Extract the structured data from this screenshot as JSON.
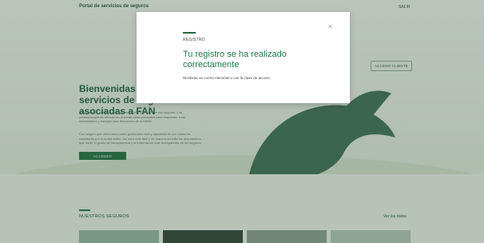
{
  "header": {
    "brand": "Portal de servicios de seguros",
    "right_label": "SALIR"
  },
  "hero": {
    "title_lines": [
      "Bienvenidas y b",
      "servicios de seg",
      "asociadas a FAN"
    ],
    "access_button": "ACCESO CLIENTE",
    "paragraph_1": [
      "Este portal le permite consultar las pólizas y gestión de sus seguros. Los",
      "productos que se ofrecen en el portal están pensados para responder a las",
      "necesidades y trabajos más frecuentes de la FANS."
    ],
    "paragraph_2": [
      "Con seguro que ofrecemos podrá gestionarlo fácil y rápidamente con todas las",
      "coberturas por lo arriba antes. Así será más fácil y de manera sencilla los documentos",
      "que nadie el grado de transparencia y la información más transparente de los seguros."
    ],
    "cta_button": "ACCEDER"
  },
  "section": {
    "title": "NUESTROS SEGUROS",
    "link": "Ver los todos"
  },
  "cards": [
    {
      "color": "#9bb4a7"
    },
    {
      "color": "#2f3b36"
    },
    {
      "color": "#8e9d96"
    },
    {
      "color": "#b9c6bf"
    }
  ],
  "modal": {
    "eyebrow": "REGISTRO",
    "title": "Tu registro se ha realizado correctamente",
    "text": "Recibirás un correo electrónico con la clave de acceso.",
    "close_icon": "close-icon"
  },
  "colors": {
    "accent": "#1f6a3f",
    "title_green": "#1f7a4a",
    "overlay": "rgba(55,90,65,0.32)"
  }
}
